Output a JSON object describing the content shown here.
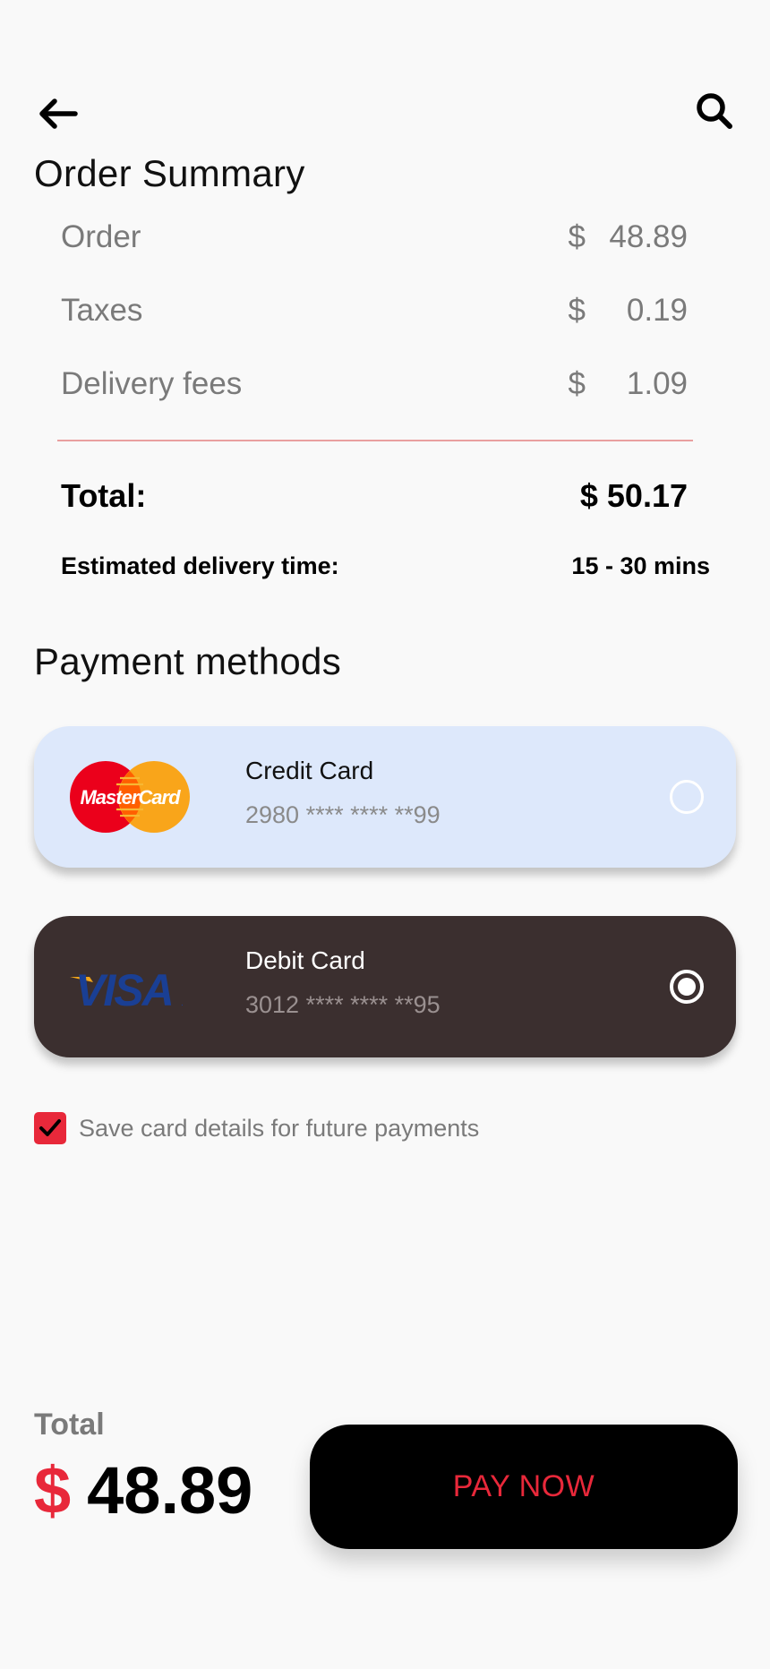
{
  "header": {
    "back_icon": "arrow-left-icon",
    "search_icon": "search-icon"
  },
  "order_summary": {
    "title": "Order Summary",
    "lines": [
      {
        "label": "Order",
        "currency": "$",
        "value": "48.89"
      },
      {
        "label": "Taxes",
        "currency": "$",
        "value": "0.19"
      },
      {
        "label": "Delivery fees",
        "currency": "$",
        "value": "1.09"
      }
    ],
    "total_label": "Total:",
    "total_value": "$ 50.17",
    "eta_label": "Estimated delivery time:",
    "eta_value": "15 - 30 mins"
  },
  "payment": {
    "title": "Payment methods",
    "cards": [
      {
        "brand": "MasterCard",
        "name": "Credit Card",
        "number": "2980 **** **** **99",
        "selected": false,
        "background": "#dde8fb"
      },
      {
        "brand": "VISA",
        "name": "Debit Card",
        "number": "3012 **** **** **95",
        "selected": true,
        "background": "#3b2f2f"
      }
    ],
    "save_label": "Save card details for future payments",
    "save_checked": true
  },
  "footer": {
    "total_label": "Total",
    "currency": "$",
    "amount": "48.89",
    "pay_label": "PAY NOW"
  },
  "colors": {
    "accent": "#e8283a",
    "divider": "#e9a0a0"
  }
}
